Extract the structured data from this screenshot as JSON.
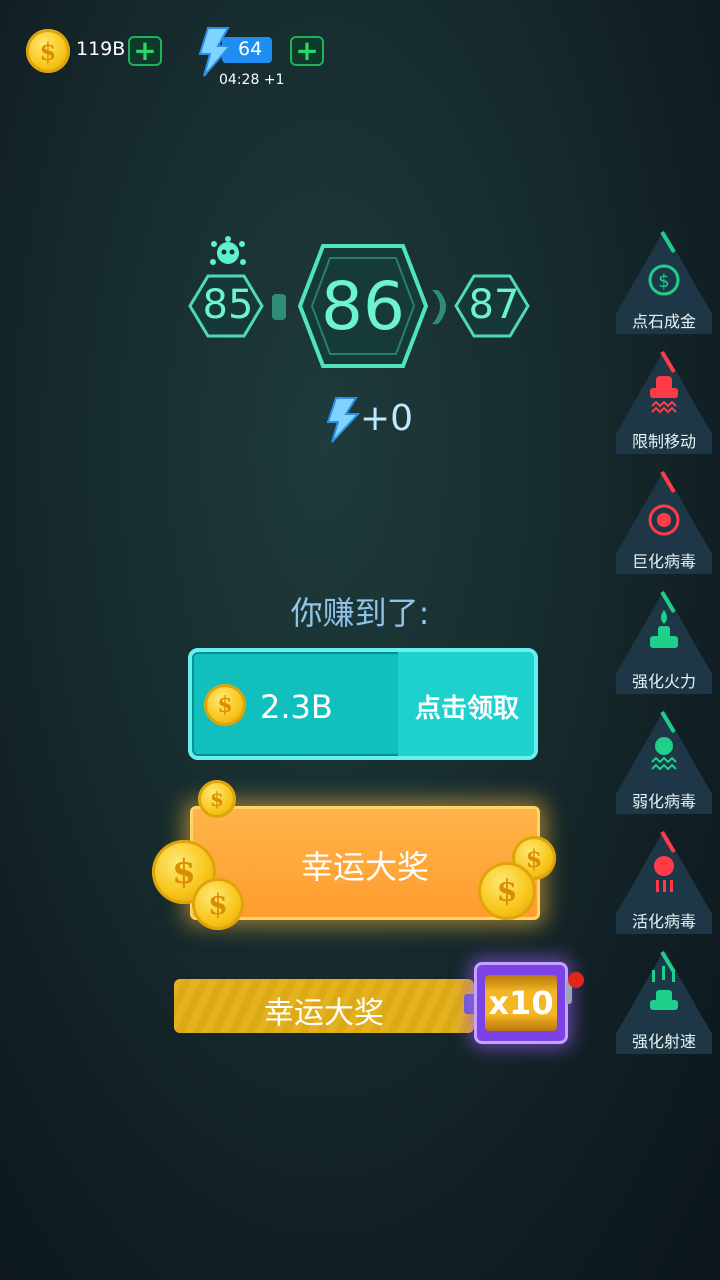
{
  "header": {
    "coins": "119B",
    "energy": "64",
    "energy_timer": "04:28 +1"
  },
  "level": {
    "previous": "85",
    "current": "86",
    "next": "87"
  },
  "energy_reward": "+0",
  "earned_title": "你赚到了:",
  "reward": {
    "amount": "2.3B",
    "claim_label": "点击领取"
  },
  "lucky_button_label": "幸运大奖",
  "lucky_bar": {
    "label": "幸运大奖",
    "multiplier": "x10"
  },
  "side_buttons": [
    {
      "label": "点石成金",
      "icon": "coin-gear-icon",
      "color": "#1fd08a"
    },
    {
      "label": "限制移动",
      "icon": "ship-wave-icon",
      "color": "#ff3b48"
    },
    {
      "label": "巨化病毒",
      "icon": "virus-target-icon",
      "color": "#ff3b48"
    },
    {
      "label": "强化火力",
      "icon": "ship-fire-icon",
      "color": "#1fd08a"
    },
    {
      "label": "弱化病毒",
      "icon": "virus-wave-icon",
      "color": "#1fd08a"
    },
    {
      "label": "活化病毒",
      "icon": "virus-active-icon",
      "color": "#ff3b48"
    },
    {
      "label": "强化射速",
      "icon": "ship-bullets-icon",
      "color": "#1fd08a"
    }
  ]
}
